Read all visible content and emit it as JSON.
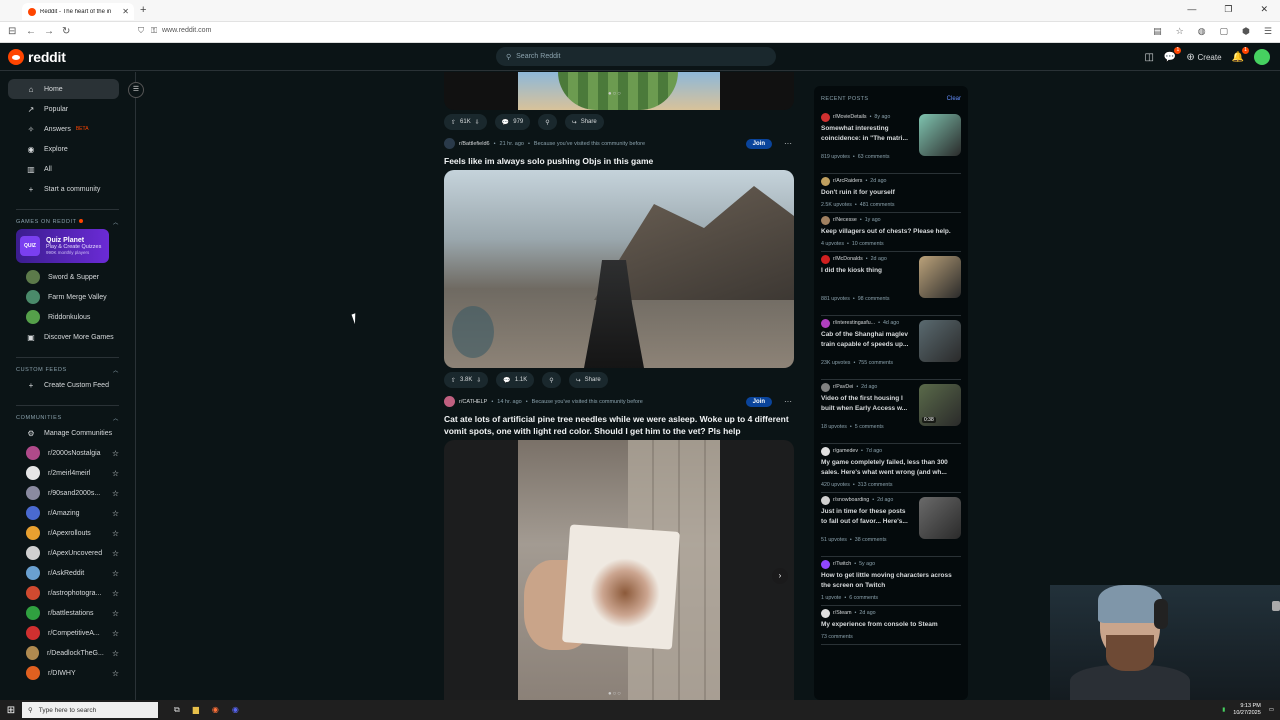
{
  "browser": {
    "tab_title": "Reddit - The heart of the in",
    "url": "www.reddit.com"
  },
  "header": {
    "logo_text": "reddit",
    "search_placeholder": "Search Reddit",
    "create_label": "Create",
    "chat_badge": "1",
    "notif_badge": "1"
  },
  "sidebar": {
    "nav": [
      {
        "label": "Home",
        "icon": "home-icon",
        "glyph": "⌂"
      },
      {
        "label": "Popular",
        "icon": "popular-icon",
        "glyph": "↗"
      },
      {
        "label": "Answers",
        "icon": "answers-icon",
        "glyph": "✧",
        "tag": "BETA"
      },
      {
        "label": "Explore",
        "icon": "explore-icon",
        "glyph": "◉"
      },
      {
        "label": "All",
        "icon": "all-icon",
        "glyph": "▥"
      },
      {
        "label": "Start a community",
        "icon": "plus-icon",
        "glyph": "+"
      }
    ],
    "games_title": "GAMES ON REDDIT",
    "quiz": {
      "icon_text": "QUIZ",
      "title": "Quiz Planet",
      "subtitle": "Play & Create Quizzes",
      "players": "990K monthly players"
    },
    "games": [
      {
        "label": "Sword & Supper",
        "color": "#5c7a4a"
      },
      {
        "label": "Farm Merge Valley",
        "color": "#4a8a6a"
      },
      {
        "label": "Riddonkulous",
        "color": "#55a04a"
      },
      {
        "label": "Discover More Games",
        "glyph": "▣"
      }
    ],
    "custom_feeds_title": "CUSTOM FEEDS",
    "create_feed": "Create Custom Feed",
    "communities_title": "COMMUNITIES",
    "manage": "Manage Communities",
    "communities": [
      {
        "label": "r/2000sNostalgia",
        "color": "#b04a8a"
      },
      {
        "label": "r/2meirl4meirl",
        "color": "#e6e6e6"
      },
      {
        "label": "r/90sand2000s...",
        "color": "#8a8aa0"
      },
      {
        "label": "r/Amazing",
        "color": "#4a6ad0"
      },
      {
        "label": "r/Apexrollouts",
        "color": "#e8a030"
      },
      {
        "label": "r/ApexUncovered",
        "color": "#d0d0d0"
      },
      {
        "label": "r/AskReddit",
        "color": "#6aa0d0"
      },
      {
        "label": "r/astrophotogra...",
        "color": "#d04a30"
      },
      {
        "label": "r/battlestations",
        "color": "#30a040"
      },
      {
        "label": "r/CompetitiveA...",
        "color": "#d03030"
      },
      {
        "label": "r/DeadlockTheG...",
        "color": "#b08a50"
      },
      {
        "label": "r/DIWHY",
        "color": "#e06020"
      }
    ]
  },
  "feed": {
    "post0": {
      "upvotes": "61K",
      "comments": "979",
      "share": "Share"
    },
    "post1": {
      "subreddit": "r/Battlefield6",
      "time": "21 hr. ago",
      "reason": "Because you've visited this community before",
      "join": "Join",
      "title": "Feels like im always solo pushing Objs in this game",
      "upvotes": "3.8K",
      "comments": "1.1K",
      "share": "Share"
    },
    "post2": {
      "subreddit": "r/CATHELP",
      "time": "14 hr. ago",
      "reason": "Because you've visited this community before",
      "join": "Join",
      "title": "Cat ate lots of artificial pine tree needles while we were asleep. Woke up to 4 different vomit spots, one with light red color. Should I get him to the vet? Pls help"
    }
  },
  "recent": {
    "title": "RECENT POSTS",
    "clear": "Clear",
    "posts": [
      {
        "sub": "r/MovieDetails",
        "age": "8y ago",
        "title": "Somewhat interesting coincidence: in \"The matri...",
        "votes": "819 upvotes",
        "comments": "63 comments",
        "thumb": "#7fc4b0",
        "color": "#d03030"
      },
      {
        "sub": "r/ArcRaiders",
        "age": "2d ago",
        "title": "Don't ruin it for yourself",
        "votes": "2.5K upvotes",
        "comments": "481 comments",
        "color": "#c0a060"
      },
      {
        "sub": "r/Necesse",
        "age": "1y ago",
        "title": "Keep villagers out of chests? Please help.",
        "votes": "4 upvotes",
        "comments": "10 comments",
        "color": "#a08060"
      },
      {
        "sub": "r/McDonalds",
        "age": "2d ago",
        "title": "I did the kiosk thing",
        "votes": "881 upvotes",
        "comments": "98 comments",
        "thumb": "#bba27a",
        "color": "#d02020"
      },
      {
        "sub": "r/interestingasfu...",
        "age": "4d ago",
        "title": "Cab of the Shanghai maglev train capable of speeds up...",
        "votes": "23K upvotes",
        "comments": "755 comments",
        "thumb": "#5a6a70",
        "color": "#b040c0"
      },
      {
        "sub": "r/PavDei",
        "age": "2d ago",
        "title": "Video of the first housing I built when Early Access w...",
        "votes": "18 upvotes",
        "comments": "5 comments",
        "thumb": "#5a6a4a",
        "duration": "0:38",
        "color": "#808080"
      },
      {
        "sub": "r/gamedev",
        "age": "7d ago",
        "title": "My game completely failed, less than 300 sales. Here's what went wrong (and wh...",
        "votes": "420 upvotes",
        "comments": "313 comments",
        "color": "#e0e0e0"
      },
      {
        "sub": "r/snowboarding",
        "age": "2d ago",
        "title": "Just in time for these posts to fall out of favor... Here's...",
        "votes": "51 upvotes",
        "comments": "38 comments",
        "thumb": "#6a6a6a",
        "color": "#d0d0d0"
      },
      {
        "sub": "r/Twitch",
        "age": "5y ago",
        "title": "How to get little moving characters across the screen on Twitch",
        "votes": "1 upvote",
        "comments": "6 comments",
        "color": "#9146ff"
      },
      {
        "sub": "r/Steam",
        "age": "2d ago",
        "title": "My experience from console to Steam",
        "votes": "73 comments",
        "comments": "",
        "color": "#e0e0e0"
      }
    ]
  },
  "taskbar": {
    "search_placeholder": "Type here to search",
    "time": "9:13 PM",
    "date": "10/27/2025"
  }
}
